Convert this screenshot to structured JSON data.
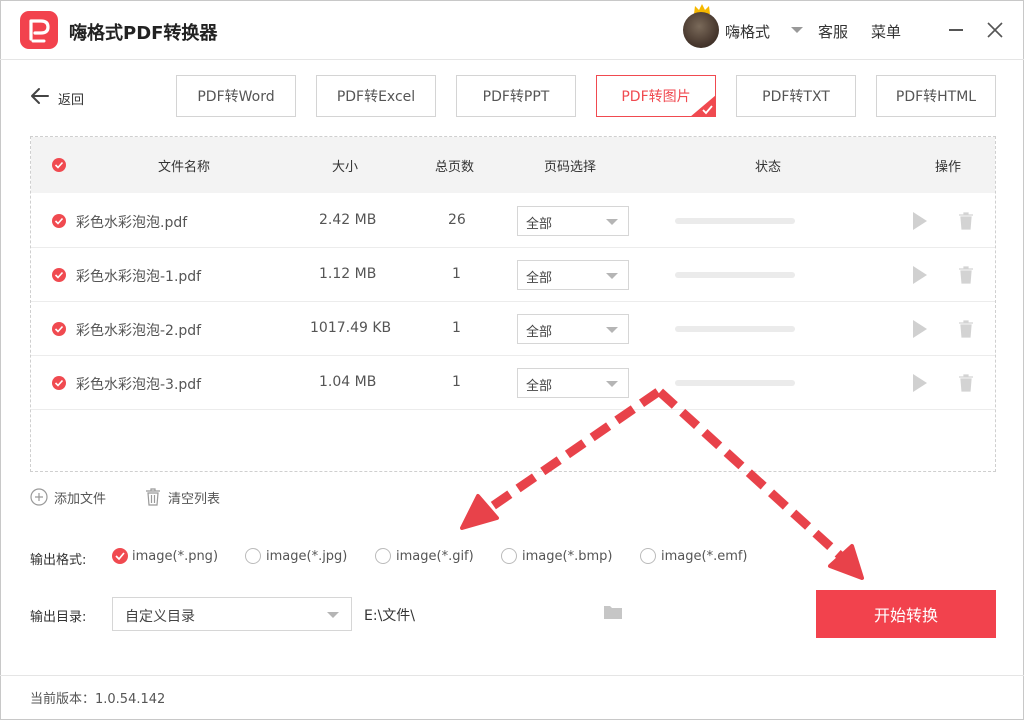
{
  "app": {
    "title": "嗨格式PDF转换器"
  },
  "header": {
    "username": "嗨格式",
    "service": "客服",
    "menu": "菜单"
  },
  "nav": {
    "back": "返回"
  },
  "tabs": [
    {
      "label": "PDF转Word",
      "active": false
    },
    {
      "label": "PDF转Excel",
      "active": false
    },
    {
      "label": "PDF转PPT",
      "active": false
    },
    {
      "label": "PDF转图片",
      "active": true
    },
    {
      "label": "PDF转TXT",
      "active": false
    },
    {
      "label": "PDF转HTML",
      "active": false
    }
  ],
  "table": {
    "headers": {
      "name": "文件名称",
      "size": "大小",
      "pages": "总页数",
      "page_select": "页码选择",
      "status": "状态",
      "ops": "操作"
    },
    "rows": [
      {
        "name": "彩色水彩泡泡.pdf",
        "size": "2.42 MB",
        "pages": "26",
        "page_select": "全部",
        "checked": true
      },
      {
        "name": "彩色水彩泡泡-1.pdf",
        "size": "1.12 MB",
        "pages": "1",
        "page_select": "全部",
        "checked": true
      },
      {
        "name": "彩色水彩泡泡-2.pdf",
        "size": "1017.49 KB",
        "pages": "1",
        "page_select": "全部",
        "checked": true
      },
      {
        "name": "彩色水彩泡泡-3.pdf",
        "size": "1.04 MB",
        "pages": "1",
        "page_select": "全部",
        "checked": true
      }
    ]
  },
  "actions": {
    "add_file": "添加文件",
    "clear_list": "清空列表"
  },
  "output": {
    "format_label": "输出格式:",
    "formats": [
      {
        "label": "image(*.png)",
        "selected": true
      },
      {
        "label": "image(*.jpg)",
        "selected": false
      },
      {
        "label": "image(*.gif)",
        "selected": false
      },
      {
        "label": "image(*.bmp)",
        "selected": false
      },
      {
        "label": "image(*.emf)",
        "selected": false
      }
    ],
    "dir_label": "输出目录:",
    "dir_option": "自定义目录",
    "dir_path": "E:\\文件\\"
  },
  "start_button": "开始转换",
  "footer": {
    "version": "当前版本：1.0.54.142"
  },
  "colors": {
    "accent": "#f2424d",
    "annotation_arrow": "#e8424a"
  },
  "icons": [
    "app-logo-icon",
    "crown-icon",
    "chevron-down-icon",
    "minimize-icon",
    "close-icon",
    "arrow-left-icon",
    "check-icon",
    "play-icon",
    "trash-icon",
    "plus-circle-icon",
    "folder-icon"
  ]
}
